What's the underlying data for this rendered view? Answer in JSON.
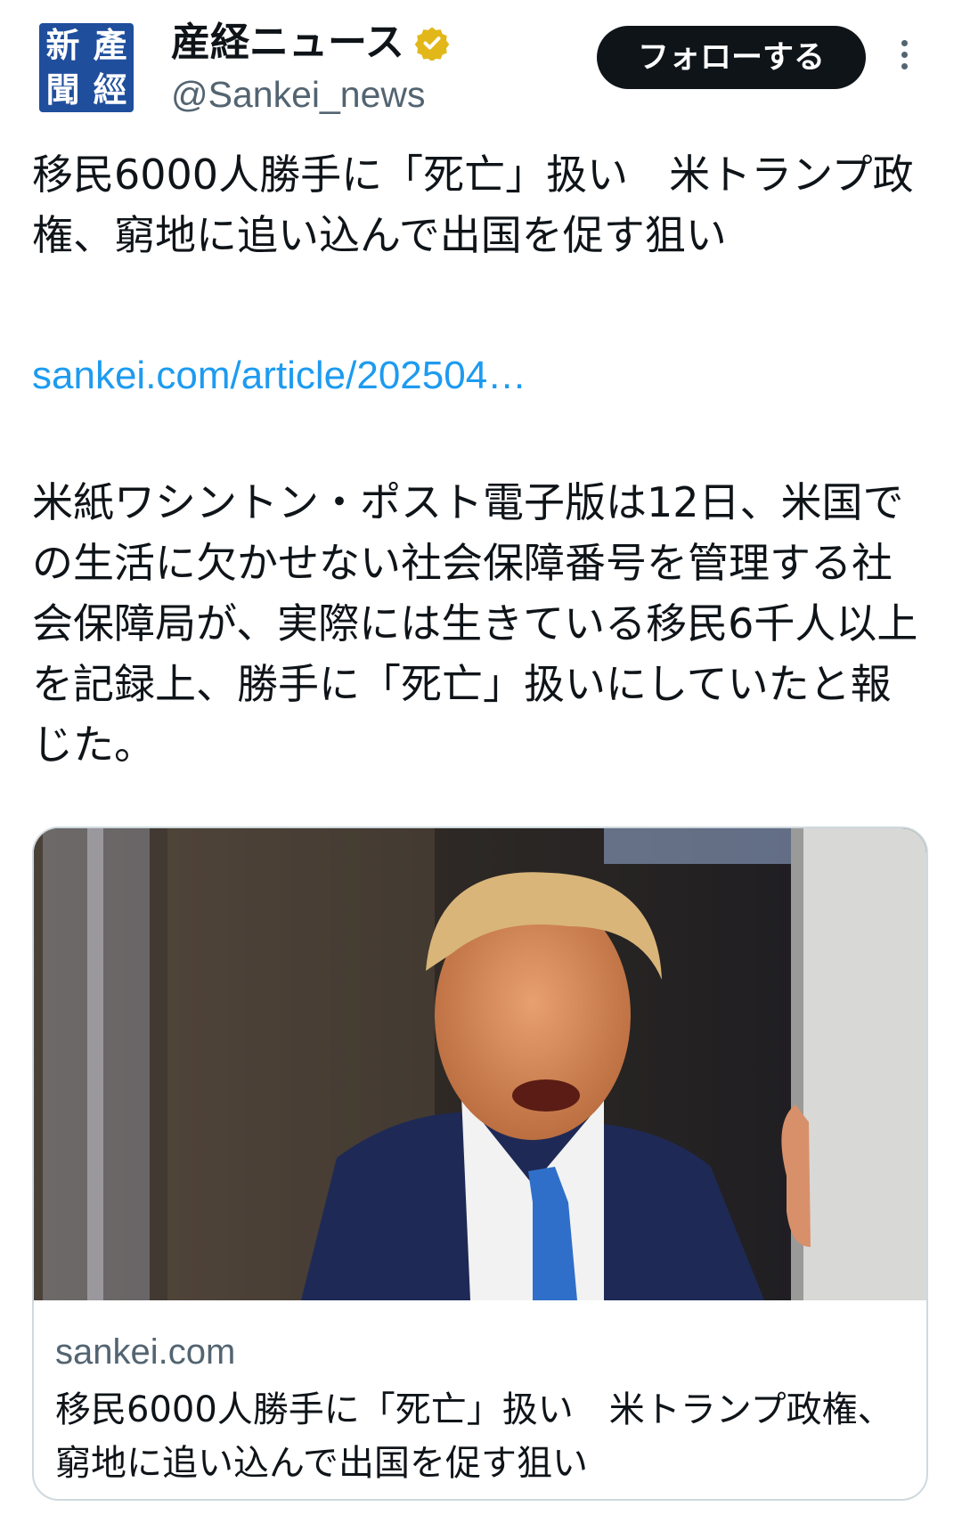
{
  "account": {
    "display_name": "産経ニュース",
    "handle": "@Sankei_news",
    "avatar_text": [
      "新",
      "產",
      "聞",
      "經"
    ],
    "verified_color": "#f4b400"
  },
  "header": {
    "follow_label": "フォローする"
  },
  "post": {
    "headline": "移民6000人勝手に「死亡」扱い　米トランプ政権、窮地に追い込んで出国を促す狙い",
    "link": "sankei.com/article/202504…",
    "body": "米紙ワシントン・ポスト電子版は12日、米国での生活に欠かせない社会保障番号を管理する社会保障局が、実際には生きている移民6千人以上を記録上、勝手に「死亡」扱いにしていたと報じた。"
  },
  "card": {
    "domain": "sankei.com",
    "title": "移民6000人勝手に「死亡」扱い　米トランプ政権、窮地に追い込んで出国を促す狙い"
  },
  "colors": {
    "link": "#1d9bf0",
    "text": "#0f1419",
    "secondary": "#536471",
    "follow_bg": "#0f1419"
  }
}
